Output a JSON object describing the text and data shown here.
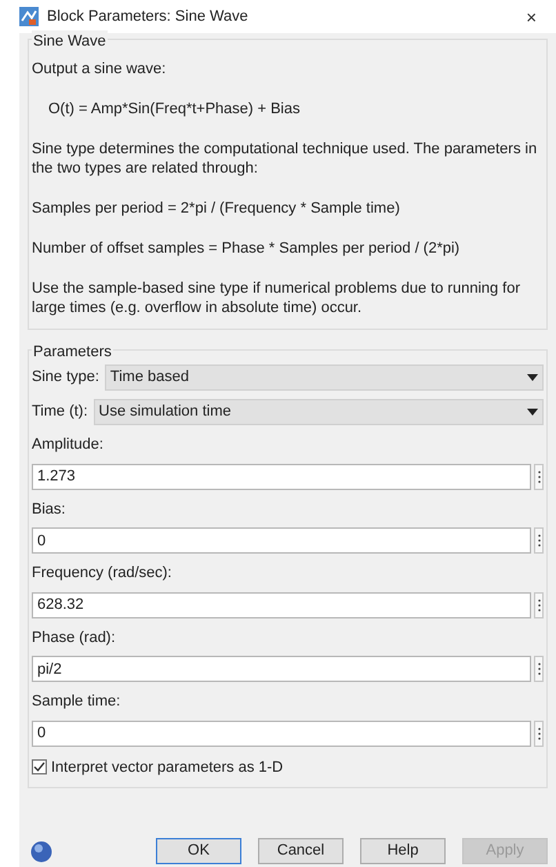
{
  "window": {
    "title": "Block Parameters: Sine Wave",
    "close": "×"
  },
  "description": {
    "title": "Sine Wave",
    "paragraphs": [
      {
        "kind": "text",
        "text": "Output a sine wave:"
      },
      {
        "kind": "formula",
        "text": "O(t) = Amp*Sin(Freq*t+Phase) + Bias"
      },
      {
        "kind": "text",
        "text": "Sine type determines the computational technique used. The parameters in the two types are related through:"
      },
      {
        "kind": "text",
        "text": "Samples per period = 2*pi / (Frequency * Sample time)"
      },
      {
        "kind": "text",
        "text": "Number of offset samples = Phase * Samples per period / (2*pi)"
      },
      {
        "kind": "text",
        "text": "Use the sample-based sine type if numerical problems due to running for large times (e.g. overflow in absolute time) occur."
      }
    ]
  },
  "parameters": {
    "title": "Parameters",
    "dropdowns": [
      {
        "label": "Sine type:",
        "value": "Time based"
      },
      {
        "label": "Time (t):",
        "value": "Use simulation time"
      }
    ],
    "fields": [
      {
        "label": "Amplitude:",
        "value": "1.273"
      },
      {
        "label": "Bias:",
        "value": "0"
      },
      {
        "label": "Frequency (rad/sec):",
        "value": "628.32"
      },
      {
        "label": "Phase (rad):",
        "value": "pi/2"
      },
      {
        "label": "Sample time:",
        "value": "0"
      }
    ],
    "checkbox": {
      "label": "Interpret vector parameters as 1-D",
      "checked": true
    }
  },
  "buttons": [
    {
      "label": "OK",
      "focused": true,
      "disabled": false
    },
    {
      "label": "Cancel",
      "focused": false,
      "disabled": false
    },
    {
      "label": "Help",
      "focused": false,
      "disabled": false
    },
    {
      "label": "Apply",
      "focused": false,
      "disabled": true
    }
  ]
}
